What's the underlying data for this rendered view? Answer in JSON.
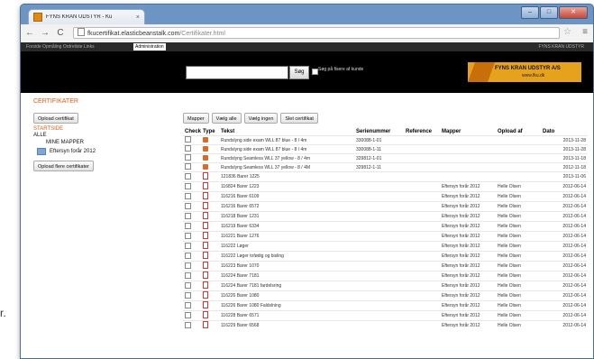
{
  "browser": {
    "tab_title": "FYNS KRAN UDSTYR - Ku",
    "tab_close": "×",
    "back": "←",
    "forward": "→",
    "reload": "C",
    "url_host": "fkucertifikat.elasticbeanstalk.com",
    "url_path": "/Certifikater.html",
    "star": "☆",
    "menu": "≡",
    "window_buttons": [
      "–",
      "□",
      "✕"
    ]
  },
  "site": {
    "topnav_left": "Forside  Opmåling  Ordreliste  Links",
    "topnav_admin": "Administration",
    "topnav_right": "FYNS KRAN UDSTYR",
    "search_button": "Søg",
    "search_checkbox_label": "Søg på fisere af kunde",
    "logo_name": "FYNS KRAN UDSTYR A/S",
    "logo_url": "www.fku.dk",
    "brand_color": "#e7a21c"
  },
  "page": {
    "section_title": "CERTIFIKATER"
  },
  "sidebar": {
    "upload_button": "Opload certifikat",
    "startside": "STARTSIDE",
    "alle": "ALLE",
    "mine_mapper": "MINE MAPPER",
    "folder": "Eftersyn forår 2012",
    "upload_multi_button": "Opload flere certifikater"
  },
  "actions": [
    "Mapper",
    "Vælg alle",
    "Vælg ingen",
    "Slet certifikat"
  ],
  "table": {
    "headers": [
      "Check",
      "Type",
      "Tekst",
      "Serienummer",
      "Reference",
      "Mapper",
      "Opload af",
      "Dato"
    ],
    "rows": [
      {
        "type": "img",
        "tekst": "Rundslyng side exam WLL 87 blue - 8 / 4m",
        "serie": "330088-1-01",
        "ref": "",
        "mapper": "",
        "af": "",
        "dato": "2013-11-28"
      },
      {
        "type": "img",
        "tekst": "Rundslyng side exam WLL 87 blue - 8 / 4m",
        "serie": "330088-1-11",
        "ref": "",
        "mapper": "",
        "af": "",
        "dato": "2013-11-28"
      },
      {
        "type": "img",
        "tekst": "Rundslyng Seamless WLL 37 yellow - 8 / 4m",
        "serie": "329812-1-01",
        "ref": "",
        "mapper": "",
        "af": "",
        "dato": "2013-11-18"
      },
      {
        "type": "img",
        "tekst": "Rundslyng Seamless WLL 37 yellow - 8 / 4M",
        "serie": "329812-1-11",
        "ref": "",
        "mapper": "",
        "af": "",
        "dato": "2012-11-18"
      },
      {
        "type": "pdf",
        "tekst": "121836 Barer 1225",
        "serie": "",
        "ref": "",
        "mapper": "",
        "af": "",
        "dato": "2013-11-06"
      },
      {
        "type": "pdf",
        "tekst": "116824 Barer 1223",
        "serie": "",
        "ref": "",
        "mapper": "Eftersyn forår 2012",
        "af": "Helle Olsen",
        "dato": "2012-06-14"
      },
      {
        "type": "pdf",
        "tekst": "116216 Barer 6109",
        "serie": "",
        "ref": "",
        "mapper": "Eftersyn forår 2012",
        "af": "Helle Olsen",
        "dato": "2012-06-14"
      },
      {
        "type": "pdf",
        "tekst": "116216 Barer 6572",
        "serie": "",
        "ref": "",
        "mapper": "Eftersyn forår 2012",
        "af": "Helle Olsen",
        "dato": "2012-06-14"
      },
      {
        "type": "pdf",
        "tekst": "116218 Barer 1231",
        "serie": "",
        "ref": "",
        "mapper": "Eftersyn forår 2012",
        "af": "Helle Olsen",
        "dato": "2012-06-14"
      },
      {
        "type": "pdf",
        "tekst": "116219 Barer 6334",
        "serie": "",
        "ref": "",
        "mapper": "Eftersyn forår 2012",
        "af": "Helle Olsen",
        "dato": "2012-06-14"
      },
      {
        "type": "pdf",
        "tekst": "116221 Barer 1276",
        "serie": "",
        "ref": "",
        "mapper": "Eftersyn forår 2012",
        "af": "Helle Olsen",
        "dato": "2012-06-14"
      },
      {
        "type": "pdf",
        "tekst": "116222 Løger",
        "serie": "",
        "ref": "",
        "mapper": "Eftersyn forår 2012",
        "af": "Helle Olsen",
        "dato": "2012-06-14"
      },
      {
        "type": "pdf",
        "tekst": "116222 Løger tofødig og bisling",
        "serie": "",
        "ref": "",
        "mapper": "Eftersyn forår 2012",
        "af": "Helle Olsen",
        "dato": "2012-06-14"
      },
      {
        "type": "pdf",
        "tekst": "116223 Barer 1070",
        "serie": "",
        "ref": "",
        "mapper": "Eftersyn forår 2012",
        "af": "Helle Olsen",
        "dato": "2012-06-14"
      },
      {
        "type": "pdf",
        "tekst": "116224 Barer 7181",
        "serie": "",
        "ref": "",
        "mapper": "Eftersyn forår 2012",
        "af": "Helle Olsen",
        "dato": "2012-06-14"
      },
      {
        "type": "pdf",
        "tekst": "116224 Barer 7181 fardelsring",
        "serie": "",
        "ref": "",
        "mapper": "Eftersyn forår 2012",
        "af": "Helle Olsen",
        "dato": "2012-06-14"
      },
      {
        "type": "pdf",
        "tekst": "116226 Barer 1080",
        "serie": "",
        "ref": "",
        "mapper": "Eftersyn forår 2012",
        "af": "Helle Olsen",
        "dato": "2012-06-14"
      },
      {
        "type": "pdf",
        "tekst": "116226 Barer 1080 Faldslning",
        "serie": "",
        "ref": "",
        "mapper": "Eftersyn forår 2012",
        "af": "Helle Olsen",
        "dato": "2012-06-14"
      },
      {
        "type": "pdf",
        "tekst": "116228 Barer 6571",
        "serie": "",
        "ref": "",
        "mapper": "Eftersyn forår 2012",
        "af": "Helle Olsen",
        "dato": "2012-06-14"
      },
      {
        "type": "pdf",
        "tekst": "116229 Barer 6568",
        "serie": "",
        "ref": "",
        "mapper": "Eftersyn forår 2012",
        "af": "Helle Olsen",
        "dato": "2012-06-14"
      }
    ]
  },
  "footer_glyph": "r."
}
